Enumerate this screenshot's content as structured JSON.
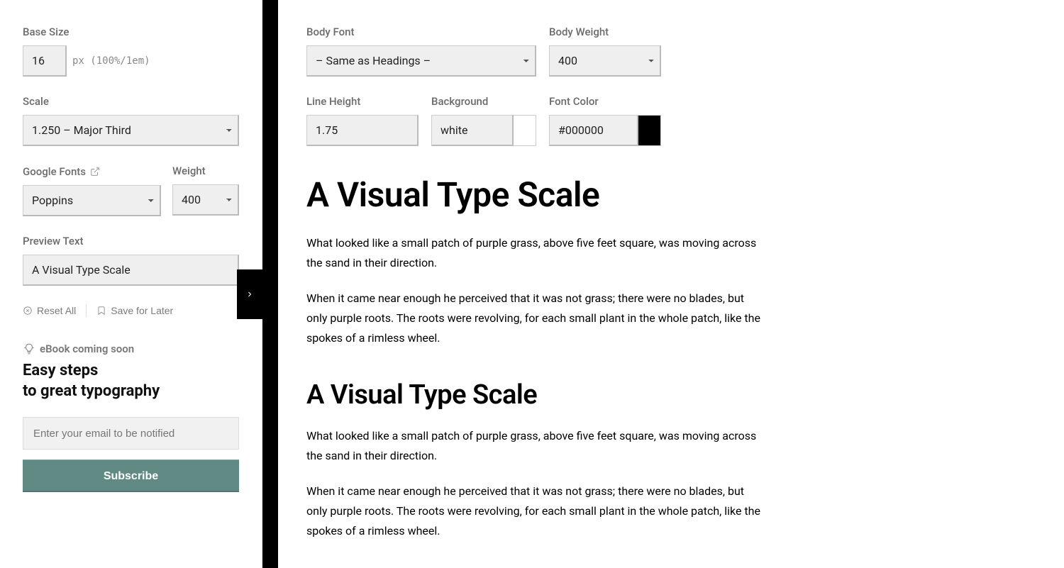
{
  "sidebar": {
    "base_size": {
      "label": "Base Size",
      "value": "16",
      "hint": "px (100%/1em)"
    },
    "scale": {
      "label": "Scale",
      "value": "1.250 – Major Third"
    },
    "google_fonts": {
      "label": "Google Fonts",
      "value": "Poppins"
    },
    "weight": {
      "label": "Weight",
      "value": "400"
    },
    "preview_text": {
      "label": "Preview Text",
      "value": "A Visual Type Scale"
    },
    "reset": "Reset All",
    "save": "Save for Later",
    "promo": {
      "tag": "eBook coming soon",
      "title_line1": "Easy steps",
      "title_line2": "to great typography",
      "email_placeholder": "Enter your email to be notified",
      "subscribe": "Subscribe"
    }
  },
  "main": {
    "body_font": {
      "label": "Body Font",
      "value": "– Same as Headings –"
    },
    "body_weight": {
      "label": "Body Weight",
      "value": "400"
    },
    "line_height": {
      "label": "Line Height",
      "value": "1.75"
    },
    "background": {
      "label": "Background",
      "value": "white",
      "swatch": "#ffffff"
    },
    "font_color": {
      "label": "Font Color",
      "value": "#000000",
      "swatch": "#000000"
    }
  },
  "preview": {
    "heading": "A Visual Type Scale",
    "p1": "What looked like a small patch of purple grass, above five feet square, was moving across the sand in their direction.",
    "p2": "When it came near enough he perceived that it was not grass; there were no blades, but only purple roots. The roots were revolving, for each small plant in the whole patch, like the spokes of a rimless wheel."
  }
}
